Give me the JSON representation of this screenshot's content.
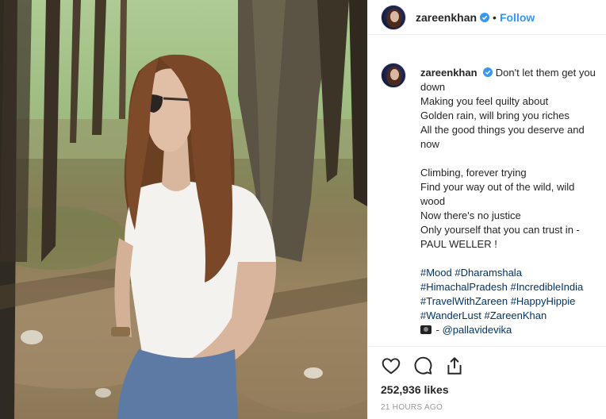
{
  "post": {
    "username": "zareenkhan",
    "follow_label": "Follow",
    "separator": "•"
  },
  "caption": {
    "username": "zareenkhan",
    "lines": [
      "Don't let them get you",
      "down",
      "Making you feel quilty about",
      "Golden rain, will bring you riches",
      "All the good things you deserve and",
      "now",
      "Climbing, forever trying",
      "Find your way out of the wild, wild",
      "wood",
      "Now there's no justice",
      "Only yourself that you can trust in -",
      "PAUL WELLER !"
    ],
    "hashtags": [
      [
        "#Mood",
        "#Dharamshala"
      ],
      [
        "#HimachalPradesh",
        "#IncredibleIndia"
      ],
      [
        "#TravelWithZareen",
        "#HappyHippie"
      ],
      [
        "#WanderLust",
        "#ZareenKhan"
      ]
    ],
    "photo_credit_prefix": "- ",
    "photo_credit": "@pallavidevika"
  },
  "engagement": {
    "likes": "252,936 likes",
    "time": "21 HOURS AGO"
  },
  "colors": {
    "link": "#003569",
    "follow": "#3897f0",
    "verified": "#3897f0"
  },
  "icons": [
    "heart-icon",
    "comment-icon",
    "share-icon",
    "camera-icon",
    "verified-badge-icon"
  ]
}
